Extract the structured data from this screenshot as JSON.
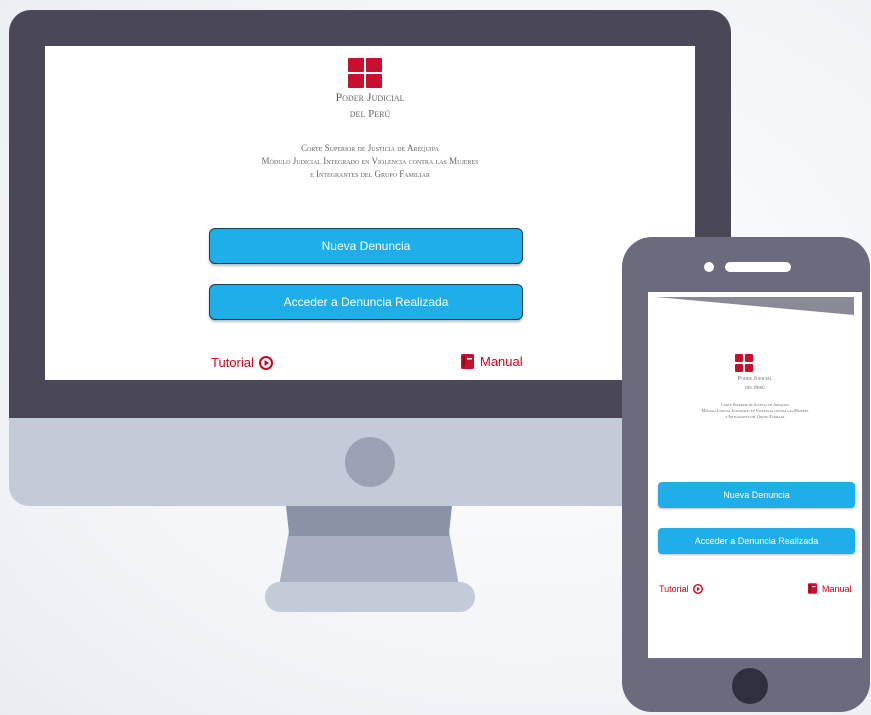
{
  "org": {
    "name_line1": "Poder Judicial",
    "name_line2": "del Perú",
    "court_line1": "Corte Superior de Justicia de Arequipa",
    "court_line2": "Módulo Judicial Integrado en Violencia contra las Mujeres",
    "court_line3": "e Integrantes del Grupo Familiar"
  },
  "actions": {
    "new_complaint": "Nueva Denuncia",
    "access_complaint": "Acceder a Denuncia Realizada",
    "tutorial": "Tutorial",
    "manual": "Manual"
  },
  "colors": {
    "brand_red": "#c8102e",
    "button_blue": "#1eaee9",
    "link_red": "#d0021b",
    "monitor_dark": "#4a4856",
    "device_light": "#c3cad8",
    "phone_body": "#6b6b7d"
  },
  "icons": {
    "logo": "pj-logo-icon",
    "tutorial": "play-circle-icon",
    "manual": "book-icon"
  }
}
